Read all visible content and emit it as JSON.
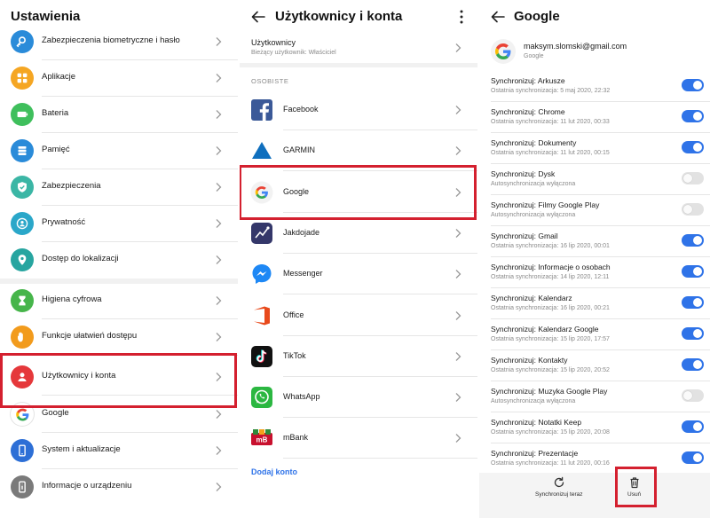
{
  "settings": {
    "title": "Ustawienia",
    "items": [
      {
        "label": "Zabezpieczenia biometryczne i hasło",
        "icon": "key-icon",
        "color": "#2a8bd9"
      },
      {
        "label": "Aplikacje",
        "icon": "apps-grid-icon",
        "color": "#f5a623"
      },
      {
        "label": "Bateria",
        "icon": "battery-icon",
        "color": "#3fbf5c"
      },
      {
        "label": "Pamięć",
        "icon": "storage-icon",
        "color": "#2a8bd9"
      },
      {
        "label": "Zabezpieczenia",
        "icon": "shield-check-icon",
        "color": "#3bb6a5"
      },
      {
        "label": "Prywatność",
        "icon": "privacy-user-icon",
        "color": "#2aa7c9"
      },
      {
        "label": "Dostęp do lokalizacji",
        "icon": "location-pin-icon",
        "color": "#27a5a0"
      },
      {
        "label": "Higiena cyfrowa",
        "icon": "hourglass-icon",
        "color": "#46b54a"
      },
      {
        "label": "Funkcje ułatwień dostępu",
        "icon": "hand-icon",
        "color": "#f29b1c"
      },
      {
        "label": "Użytkownicy i konta",
        "icon": "user-icon",
        "color": "#e5383b"
      },
      {
        "label": "Google",
        "icon": "google-g-icon",
        "color": "#ffffff"
      },
      {
        "label": "System i aktualizacje",
        "icon": "phone-info-icon",
        "color": "#2d6fd6"
      },
      {
        "label": "Informacje o urządzeniu",
        "icon": "device-info-icon",
        "color": "#7a7a7a"
      }
    ]
  },
  "accounts": {
    "title": "Użytkownicy i konta",
    "users_label": "Użytkownicy",
    "current_user": "Bieżący użytkownik: Właściciel",
    "section": "OSOBISTE",
    "items": [
      {
        "label": "Facebook",
        "icon": "facebook-logo-icon"
      },
      {
        "label": "GARMIN",
        "icon": "garmin-triangle-icon"
      },
      {
        "label": "Google",
        "icon": "google-g-icon"
      },
      {
        "label": "Jakdojade",
        "icon": "jakdojade-icon"
      },
      {
        "label": "Messenger",
        "icon": "messenger-icon"
      },
      {
        "label": "Office",
        "icon": "office-icon"
      },
      {
        "label": "TikTok",
        "icon": "tiktok-icon"
      },
      {
        "label": "WhatsApp",
        "icon": "whatsapp-icon"
      },
      {
        "label": "mBank",
        "icon": "mbank-icon"
      }
    ],
    "add_account": "Dodaj konto"
  },
  "google": {
    "title": "Google",
    "email": "maksym.slomski@gmail.com",
    "provider": "Google",
    "syncs": [
      {
        "title": "Synchronizuj: Arkusze",
        "sub": "Ostatnia synchronizacja: 5 maj 2020, 22:32",
        "on": true
      },
      {
        "title": "Synchronizuj: Chrome",
        "sub": "Ostatnia synchronizacja: 11 lut 2020, 00:33",
        "on": true
      },
      {
        "title": "Synchronizuj: Dokumenty",
        "sub": "Ostatnia synchronizacja: 11 lut 2020, 00:15",
        "on": true
      },
      {
        "title": "Synchronizuj: Dysk",
        "sub": "Autosynchronizacja wyłączona",
        "on": false
      },
      {
        "title": "Synchronizuj: Filmy Google Play",
        "sub": "Autosynchronizacja wyłączona",
        "on": false
      },
      {
        "title": "Synchronizuj: Gmail",
        "sub": "Ostatnia synchronizacja: 16 lip 2020, 00:01",
        "on": true
      },
      {
        "title": "Synchronizuj: Informacje o osobach",
        "sub": "Ostatnia synchronizacja: 14 lip 2020, 12:11",
        "on": true
      },
      {
        "title": "Synchronizuj: Kalendarz",
        "sub": "Ostatnia synchronizacja: 16 lip 2020, 00:21",
        "on": true
      },
      {
        "title": "Synchronizuj: Kalendarz Google",
        "sub": "Ostatnia synchronizacja: 15 lip 2020, 17:57",
        "on": true
      },
      {
        "title": "Synchronizuj: Kontakty",
        "sub": "Ostatnia synchronizacja: 15 lip 2020, 20:52",
        "on": true
      },
      {
        "title": "Synchronizuj: Muzyka Google Play",
        "sub": "Autosynchronizacja wyłączona",
        "on": false
      },
      {
        "title": "Synchronizuj: Notatki Keep",
        "sub": "Ostatnia synchronizacja: 15 lip 2020, 20:08",
        "on": true
      },
      {
        "title": "Synchronizuj: Prezentacje",
        "sub": "Ostatnia synchronizacja: 11 lut 2020, 00:16",
        "on": true
      }
    ],
    "sync_now": "Synchronizuj teraz",
    "remove": "Usuń"
  },
  "colors": {
    "accent": "#2f73e8",
    "highlight": "#d4202f"
  }
}
